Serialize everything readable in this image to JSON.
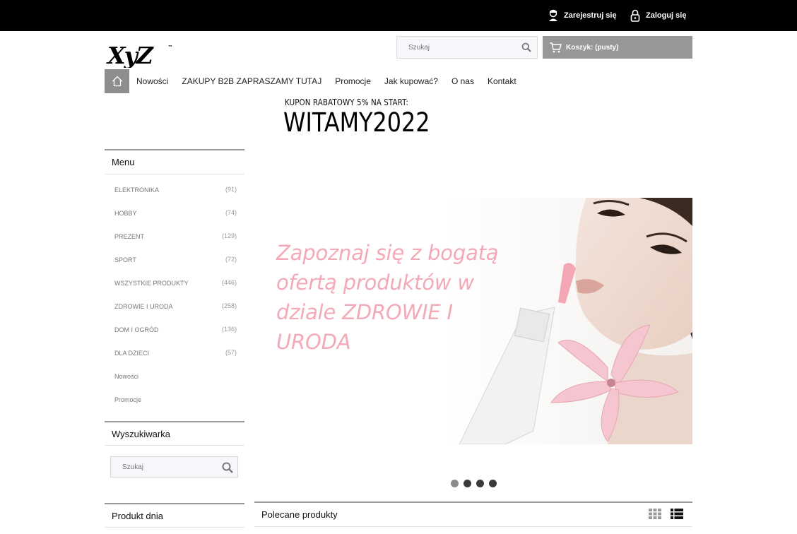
{
  "topbar": {
    "register_label": "Zarejestruj się",
    "login_label": "Zaloguj się"
  },
  "header": {
    "logo_text": "XyZ",
    "search_placeholder": "Szukaj",
    "cart_label": "Koszyk: (pusty)"
  },
  "nav": {
    "items": [
      {
        "label": "Nowości"
      },
      {
        "label": "ZAKUPY B2B ZAPRASZAMY TUTAJ"
      },
      {
        "label": "Promocje"
      },
      {
        "label": "Jak kupować?"
      },
      {
        "label": "O nas"
      },
      {
        "label": "Kontakt"
      }
    ]
  },
  "coupon": {
    "line1": "KUPON RABATOWY 5% NA START:",
    "code": "WITAMY2022"
  },
  "sidebar": {
    "menu_title": "Menu",
    "menu_items": [
      {
        "label": "ELEKTRONIKA",
        "count": "(91)"
      },
      {
        "label": "HOBBY",
        "count": "(74)"
      },
      {
        "label": "PREZENT",
        "count": "(129)"
      },
      {
        "label": "SPORT",
        "count": "(72)"
      },
      {
        "label": "WSZYSTKIE PRODUKTY",
        "count": "(446)"
      },
      {
        "label": "ZDROWIE I URODA",
        "count": "(258)"
      },
      {
        "label": "DOM I OGRÓD",
        "count": "(136)"
      },
      {
        "label": "DLA DZIECI",
        "count": "(57)"
      },
      {
        "label": "Nowości",
        "count": ""
      },
      {
        "label": "Promocje",
        "count": ""
      }
    ],
    "search_title": "Wyszukiwarka",
    "search_placeholder": "Szukaj",
    "product_of_day_title": "Produkt dnia"
  },
  "banner": {
    "text": "Zapoznaj się z bogatą ofertą produktów w dziale ZDROWIE I URODA",
    "slide_count": 4,
    "active_slide": 1,
    "text_color": "#f4a9b7"
  },
  "featured": {
    "title": "Polecane produkty"
  },
  "colors": {
    "topbar": "#000000",
    "cart_bg": "#979797",
    "home_bg": "#8e8e8e"
  }
}
